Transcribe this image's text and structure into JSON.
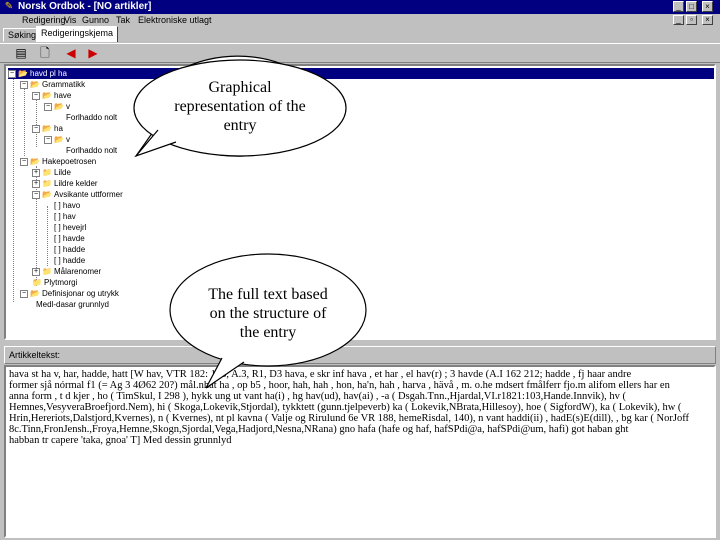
{
  "window": {
    "title": "Norsk Ordbok - [NO artikler]",
    "app_icon": "app-icon",
    "buttons": [
      "minimize-icon",
      "maximize-icon",
      "close-icon"
    ]
  },
  "menu": {
    "items": [
      "Redigering",
      "Vis",
      "Gunno",
      "Tak",
      "Elektroniske utlagt"
    ]
  },
  "tabs": [
    "Søking",
    "Redigeringskjema"
  ],
  "toolbar": {
    "icons": [
      "document-icon",
      "new-document-icon",
      "arrow-left-icon",
      "arrow-right-icon"
    ]
  },
  "tree": {
    "rows": [
      {
        "label": "havd pl ha",
        "selected": true
      },
      {
        "label": "Grammatikk"
      },
      {
        "label": "have"
      },
      {
        "label": "v"
      },
      {
        "label": "Forlhaddo nolt"
      },
      {
        "label": "ha"
      },
      {
        "label": "v"
      },
      {
        "label": "Forlhaddo nolt"
      },
      {
        "label": "Hakepoetrosen"
      },
      {
        "label": "Lilde"
      },
      {
        "label": "Lildre kelder"
      },
      {
        "label": "Avsikante uttformer"
      },
      {
        "label": "[ ] havo"
      },
      {
        "label": "[ ] hav"
      },
      {
        "label": "[ ] hevejrl"
      },
      {
        "label": "[ ] havde"
      },
      {
        "label": "[ ] hadde"
      },
      {
        "label": "[ ] hadde"
      },
      {
        "label": "[ ] havl"
      },
      {
        "label": "Målarenomer"
      },
      {
        "label": "Plytmorgi"
      },
      {
        "label": "Definisjonar og utrykk"
      },
      {
        "label": "Medl-dasar grunnlyd"
      }
    ]
  },
  "article": {
    "header": "Artikkeltekst:",
    "lines": [
      "hava st ha v, har, hadde, hatt [W hav, VTR 182: 128, A.3, R1, D3 hava, e skr inf hava , et har , el hav(r) ; 3 havde (A.I 162 212; hadde , fj haar andre",
      "former sjå nórmal f1 (= Ag 3 4Ø62 20?) mål.nhat ha , op b5 , hoor, hah, hah , hon, ha'n, hah , harva , hävå , m. o.he mdsert fmålferr fjo.m alifom ellers har en",
      "anna form , t d kjer , ho ( TimSkul, I 298 ), hykk ung ut vant ha(i) , hg hav(ud), hav(ai) , -a ( Dsgah.Tnn.,Hjardal,VI.r1821:103,Hande.Innvik), hv (",
      "Hemnes,VesyveraBroefjord.Nem), hi ( Skoga,Lokevik,Stjordal), tykktett (gunn.tjelpeverb) ka ( Lokevik,NBrata,Hillesoy), hoe ( SigfordW), ka ( Lokevik), hw (",
      "Hrin,Hereriots,Dalstjord,Kvernes), n ( Kvernes), nt pl kavna ( Valje og Rirulund 6e VR 188, hemeRisdal, 140), n vant haddi(ii) , hadE(s)E(dill), , bg kar ( NorJoff",
      "8c.Tinn,FronJensh.,Froya,Hemne,Skogn,Sjordal,Vega,Hadjord,Nesna,NRana) gno hafa (hafe og haf, hafSPdi@a, hafSPdi@um, hafi) got haban ght",
      "habban tr capere 'taka, gnoa' T] Med dessin grunnlyd"
    ]
  },
  "callouts": [
    {
      "text": "Graphical representation of the entry"
    },
    {
      "text": "The full text based on the structure of the entry"
    }
  ]
}
